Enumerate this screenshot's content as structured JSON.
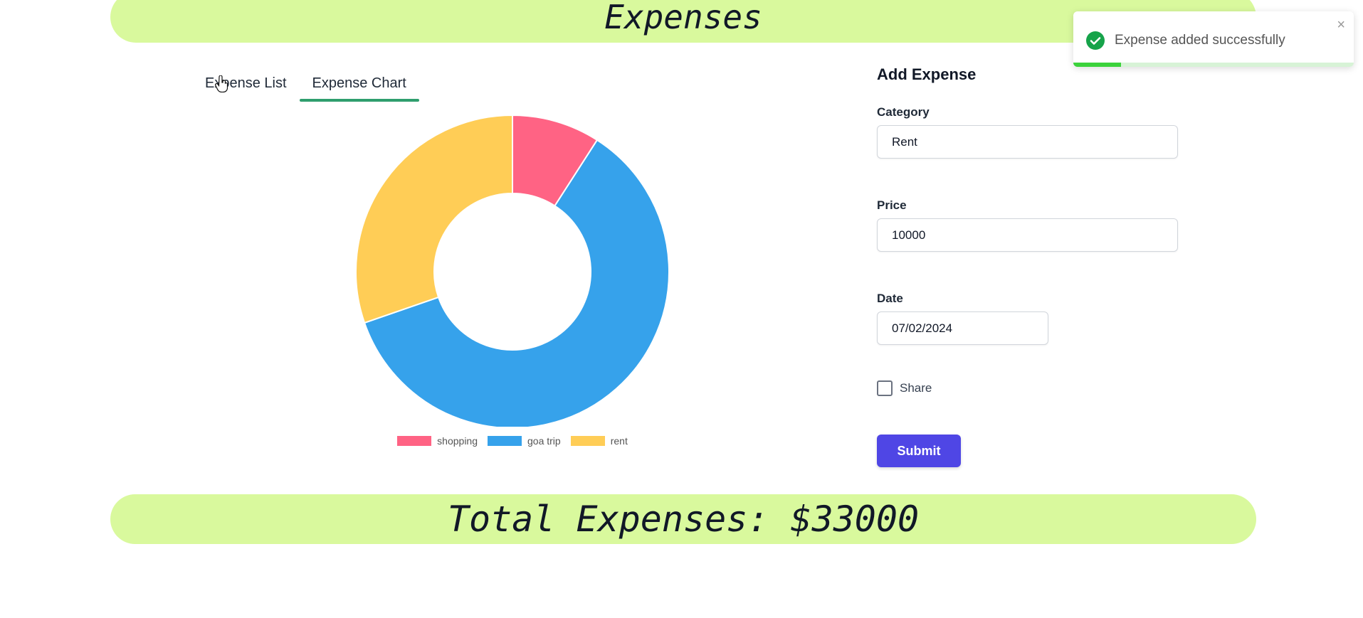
{
  "header": {
    "title": "Expenses"
  },
  "tabs": [
    {
      "label": "Expense List",
      "active": false
    },
    {
      "label": "Expense Chart",
      "active": true
    }
  ],
  "chart_data": {
    "type": "pie",
    "donut": true,
    "categories": [
      "shopping",
      "goa trip",
      "rent"
    ],
    "values": [
      3000,
      20000,
      10000
    ],
    "colors": [
      "#ff6384",
      "#36a2eb",
      "#ffcd56"
    ],
    "legend": "bottom"
  },
  "form": {
    "title": "Add Expense",
    "category_label": "Category",
    "category_value": "Rent",
    "price_label": "Price",
    "price_value": "10000",
    "date_label": "Date",
    "date_value": "07/02/2024",
    "share_label": "Share",
    "share_checked": false,
    "submit_label": "Submit"
  },
  "footer": {
    "total_text": "Total Expenses: $33000"
  },
  "toast": {
    "message": "Expense added successfully",
    "close_glyph": "×",
    "progress": 0.17,
    "accent": "#22c55e"
  }
}
